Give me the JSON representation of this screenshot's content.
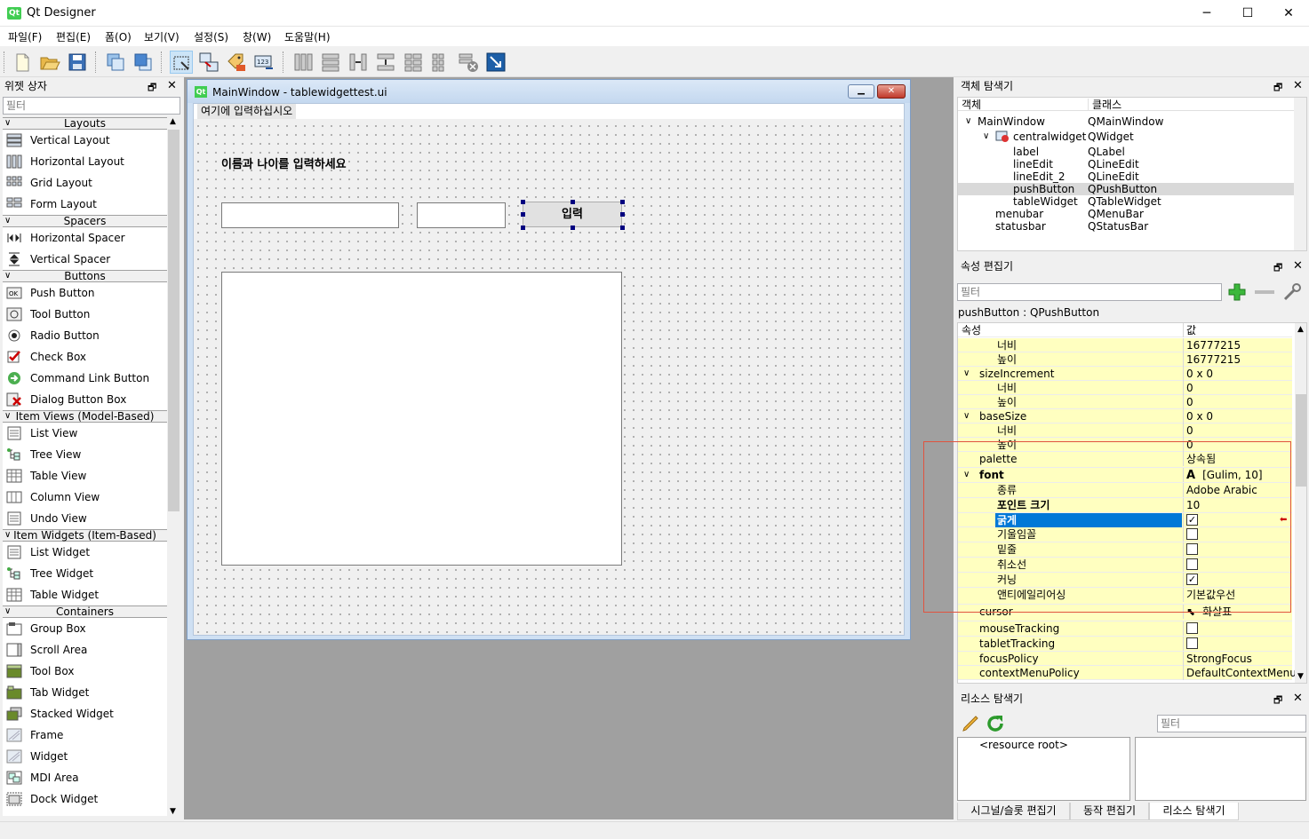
{
  "app": {
    "title": "Qt Designer",
    "icon_text": "Qt",
    "min": "─",
    "max": "☐",
    "close": "✕"
  },
  "menu": [
    "파일(F)",
    "편집(E)",
    "폼(O)",
    "보기(V)",
    "설정(S)",
    "창(W)",
    "도움말(H)"
  ],
  "widget_box": {
    "title": "위젯 상자",
    "filter_placeholder": "필터",
    "categories": [
      {
        "name": "Layouts",
        "items": [
          "Vertical Layout",
          "Horizontal Layout",
          "Grid Layout",
          "Form Layout"
        ]
      },
      {
        "name": "Spacers",
        "items": [
          "Horizontal Spacer",
          "Vertical Spacer"
        ]
      },
      {
        "name": "Buttons",
        "items": [
          "Push Button",
          "Tool Button",
          "Radio Button",
          "Check Box",
          "Command Link Button",
          "Dialog Button Box"
        ]
      },
      {
        "name": "Item Views (Model-Based)",
        "items": [
          "List View",
          "Tree View",
          "Table View",
          "Column View",
          "Undo View"
        ]
      },
      {
        "name": "Item Widgets (Item-Based)",
        "items": [
          "List Widget",
          "Tree Widget",
          "Table Widget"
        ]
      },
      {
        "name": "Containers",
        "items": [
          "Group Box",
          "Scroll Area",
          "Tool Box",
          "Tab Widget",
          "Stacked Widget",
          "Frame",
          "Widget",
          "MDI Area",
          "Dock Widget"
        ]
      }
    ]
  },
  "form": {
    "title": "MainWindow - tablewidgettest.ui",
    "icon_text": "Qt",
    "menu_placeholder": "여기에 입력하십시오",
    "label_text": "이름과 나이를 입력하세요",
    "button_text": "입력"
  },
  "object_inspector": {
    "title": "객체 탐색기",
    "col_object": "객체",
    "col_class": "클래스",
    "rows": [
      {
        "name": "MainWindow",
        "class": "QMainWindow"
      },
      {
        "name": "centralwidget",
        "class": "QWidget"
      },
      {
        "name": "label",
        "class": "QLabel"
      },
      {
        "name": "lineEdit",
        "class": "QLineEdit"
      },
      {
        "name": "lineEdit_2",
        "class": "QLineEdit"
      },
      {
        "name": "pushButton",
        "class": "QPushButton"
      },
      {
        "name": "tableWidget",
        "class": "QTableWidget"
      },
      {
        "name": "menubar",
        "class": "QMenuBar"
      },
      {
        "name": "statusbar",
        "class": "QStatusBar"
      }
    ]
  },
  "property_editor": {
    "title": "속성 편집기",
    "filter_placeholder": "필터",
    "object_label": "pushButton : QPushButton",
    "col_prop": "속성",
    "col_value": "값",
    "rows": [
      {
        "name": "너비",
        "value": "16777215"
      },
      {
        "name": "높이",
        "value": "16777215"
      },
      {
        "name": "sizeIncrement",
        "value": "0 x 0"
      },
      {
        "name": "너비",
        "value": "0"
      },
      {
        "name": "높이",
        "value": "0"
      },
      {
        "name": "baseSize",
        "value": "0 x 0"
      },
      {
        "name": "너비",
        "value": "0"
      },
      {
        "name": "높이",
        "value": "0"
      },
      {
        "name": "palette",
        "value": "상속됨"
      },
      {
        "name": "font",
        "value": "[Gulim, 10]"
      },
      {
        "name": "종류",
        "value": "Adobe Arabic"
      },
      {
        "name": "포인트 크기",
        "value": "10"
      },
      {
        "name": "굵게",
        "value": ""
      },
      {
        "name": "기울임꼴",
        "value": ""
      },
      {
        "name": "밑줄",
        "value": ""
      },
      {
        "name": "취소선",
        "value": ""
      },
      {
        "name": "커닝",
        "value": ""
      },
      {
        "name": "앤티에일리어싱",
        "value": "기본값우선"
      },
      {
        "name": "cursor",
        "value": "화살표"
      },
      {
        "name": "mouseTracking",
        "value": ""
      },
      {
        "name": "tabletTracking",
        "value": ""
      },
      {
        "name": "focusPolicy",
        "value": "StrongFocus"
      },
      {
        "name": "contextMenuPolicy",
        "value": "DefaultContextMenu"
      }
    ]
  },
  "resource_browser": {
    "title": "리소스 탐색기",
    "filter_placeholder": "필터",
    "root": "<resource root>"
  },
  "bottom_tabs": [
    "시그널/슬롯 편집기",
    "동작 편집기",
    "리소스 탐색기"
  ],
  "colors": {
    "accent": "#0078d7",
    "highlight_box": "#e0533f",
    "property_yellow": "#ffffc0"
  }
}
